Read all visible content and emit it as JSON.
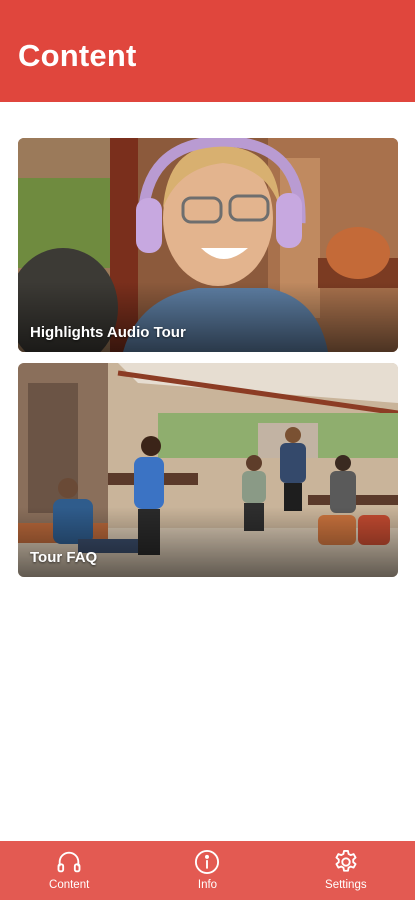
{
  "header": {
    "title": "Content"
  },
  "cards": [
    {
      "label": "Highlights Audio Tour"
    },
    {
      "label": "Tour FAQ"
    }
  ],
  "tabbar": {
    "tabs": [
      {
        "label": "Content",
        "icon": "headphones-icon"
      },
      {
        "label": "Info",
        "icon": "info-icon"
      },
      {
        "label": "Settings",
        "icon": "gear-icon"
      }
    ]
  },
  "colors": {
    "header": "#e0463d",
    "tabbar": "#e35a52"
  }
}
